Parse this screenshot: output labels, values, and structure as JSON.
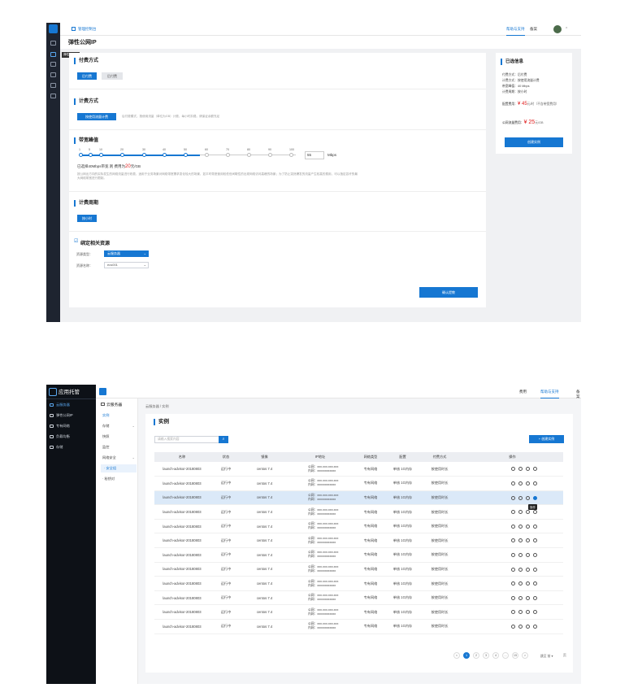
{
  "screen1": {
    "header": {
      "logo_text": "管理控制台",
      "help": "帮助与支持",
      "backup": "备案"
    },
    "page_title": "弹性公网IP",
    "tooltip": "弹性公网IP",
    "payment": {
      "title": "付费方式",
      "options": [
        "后付费",
        "后付费"
      ]
    },
    "billing": {
      "title": "计费方式",
      "option": "按使用流量计费",
      "hint": "后付费模式，按使用流量（单位为GB）计费，每小时扣费。请保证余额充足"
    },
    "bandwidth": {
      "title": "带宽峰值",
      "ticks": [
        "1",
        "5",
        "10",
        "20",
        "30",
        "40",
        "50",
        "60",
        "70",
        "80",
        "90",
        "100"
      ],
      "value": "55",
      "unit": "Mbps",
      "selected_prefix": "已选择40Mbps带宽 则 费用为",
      "price": "20",
      "price_unit": "元/GB",
      "selected_fraction": 0.4,
      "note": "按公网出方向的实际发生的网络流量进行收费，适用于业务场景对网络带宽需求变化较大的场景，如平时带宽使用较低但间歇性的出现网络访问高峰的场景；为了防止突然爆发的流量产生较高的费用，可以指定容许的最大网络带宽进行限制。"
    },
    "period": {
      "title": "计费周期",
      "option": "按小时"
    },
    "bind": {
      "title": "绑定相关资源",
      "type_label": "资源类型：",
      "type_value": "云服务器",
      "name_label": "资源名称：",
      "name_value": "ecs001"
    },
    "confirm": "确认提教",
    "summary": {
      "title": "已选信息",
      "rows": [
        "付费方式：后付费",
        "计费方式：按使用流量计费",
        "带宽峰值：40 Mbps",
        "计费周期：按小时"
      ],
      "config_label": "配置费用：",
      "config_price": "¥ 45",
      "config_unit": "元/时（不含带宽费用）",
      "traffic_label": "公网流量费用：",
      "traffic_price": "¥ 25",
      "traffic_unit": "元/GB",
      "create": "创建实例"
    }
  },
  "screen2": {
    "brand": "应用托管",
    "nav": [
      "云服务器",
      "弹性公网IP",
      "专有网络",
      "负载均衡",
      "存储"
    ],
    "header": {
      "fee": "费用",
      "help": "帮助与支持",
      "backup": "备案"
    },
    "subnav": {
      "title": "云服务器",
      "items": [
        "实例",
        "存储",
        "快照",
        "监控",
        "网络安全",
        "· 安全组",
        "· 秘钥对"
      ]
    },
    "breadcrumb": "云服务器 / 实例",
    "title": "实例",
    "search_placeholder": "请输入搜索内容",
    "create": "+ 创建实例",
    "columns": [
      "名称",
      "状态",
      "镜像",
      "IP地址",
      "网络类型",
      "配置",
      "付费方式",
      "操作"
    ],
    "rows": [
      [
        "launch-advisor-20180803",
        "运行中",
        "centos 7.4",
        "公网：xxx.xxx.xxx.xxx",
        "内网：xxxxxxxxxxxx",
        "专有网络",
        "单核 1G内存",
        "按使用时长"
      ],
      [
        "launch-advisor-20180803",
        "运行中",
        "centos 7.4",
        "公网：xxx.xxx.xxx.xxx",
        "内网：xxxxxxxxxxxx",
        "专有网络",
        "单核 1G内存",
        "按使用时长"
      ],
      [
        "launch-advisor-20180803",
        "运行中",
        "centos 7.4",
        "公网：xxx.xxx.xxx.xxx",
        "内网：xxxxxxxxxxxx",
        "专有网络",
        "单核 1G内存",
        "按使用时长"
      ],
      [
        "launch-advisor-20180803",
        "运行中",
        "centos 7.4",
        "公网：xxx.xxx.xxx.xxx",
        "内网：xxxxxxxxxxxx",
        "专有网络",
        "单核 1G内存",
        "按使用时长"
      ],
      [
        "launch-advisor-20180803",
        "运行中",
        "centos 7.4",
        "公网：xxx.xxx.xxx.xxx",
        "内网：xxxxxxxxxxxx",
        "专有网络",
        "单核 1G内存",
        "按使用时长"
      ],
      [
        "launch-advisor-20180803",
        "运行中",
        "centos 7.4",
        "公网：xxx.xxx.xxx.xxx",
        "内网：xxxxxxxxxxxx",
        "专有网络",
        "单核 1G内存",
        "按使用时长"
      ],
      [
        "launch-advisor-20180803",
        "运行中",
        "centos 7.4",
        "公网：xxx.xxx.xxx.xxx",
        "内网：xxxxxxxxxxxx",
        "专有网络",
        "单核 1G内存",
        "按使用时长"
      ],
      [
        "launch-advisor-20180803",
        "运行中",
        "centos 7.4",
        "公网：xxx.xxx.xxx.xxx",
        "内网：xxxxxxxxxxxx",
        "专有网络",
        "单核 1G内存",
        "按使用时长"
      ],
      [
        "launch-advisor-20180803",
        "运行中",
        "centos 7.4",
        "公网：xxx.xxx.xxx.xxx",
        "内网：xxxxxxxxxxxx",
        "专有网络",
        "单核 1G内存",
        "按使用时长"
      ],
      [
        "launch-advisor-20180803",
        "运行中",
        "centos 7.4",
        "公网：xxx.xxx.xxx.xxx",
        "内网：xxxxxxxxxxxx",
        "专有网络",
        "单核 1G内存",
        "按使用时长"
      ],
      [
        "launch-advisor-20180803",
        "运行中",
        "centos 7.4",
        "公网：xxx.xxx.xxx.xxx",
        "内网：xxxxxxxxxxxx",
        "专有网络",
        "单核 1G内存",
        "按使用时长"
      ],
      [
        "launch-advisor-20180803",
        "运行中",
        "centos 7.4",
        "公网：xxx.xxx.xxx.xxx",
        "内网：xxxxxxxxxxxx",
        "专有网络",
        "单核 1G内存",
        "按使用时长"
      ]
    ],
    "highlighted_row": 2,
    "op_tooltip": "操作",
    "pagination": {
      "prev": "<",
      "pages": [
        "1",
        "2",
        "3",
        "4",
        "...",
        "15"
      ],
      "next": ">",
      "goto": "跳至 前 ▾",
      "page_label": "页"
    },
    "colors": {
      "accent": "#1677d2",
      "sidebar": "#0d1117"
    }
  }
}
